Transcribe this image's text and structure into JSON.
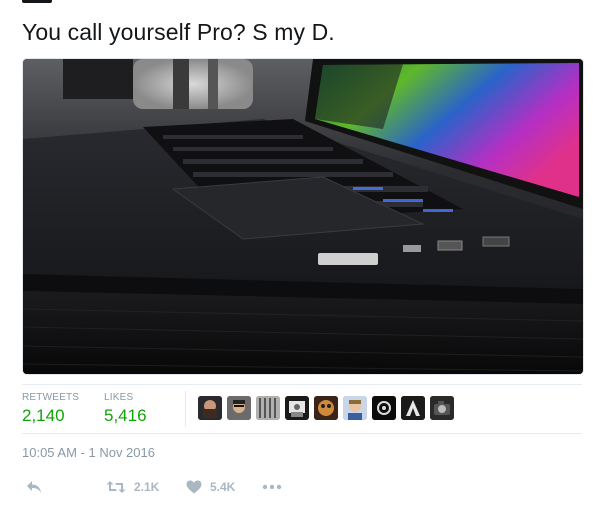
{
  "tweet": {
    "text": "You call yourself Pro? S my D.",
    "image_alt_description_icon": "laptop-photo"
  },
  "stats": {
    "retweets_label": "RETWEETS",
    "retweets_value": "2,140",
    "likes_label": "LIKES",
    "likes_value": "5,416",
    "stat_color": "#12a40a",
    "avatar_count": 9
  },
  "meta": {
    "timestamp": "10:05 AM - 1 Nov 2016"
  },
  "actions": {
    "reply_icon": "reply-icon",
    "retweet_icon": "retweet-icon",
    "retweet_count": "2.1K",
    "like_icon": "heart-icon",
    "like_count": "5.4K",
    "more_icon": "more-dots-icon"
  }
}
